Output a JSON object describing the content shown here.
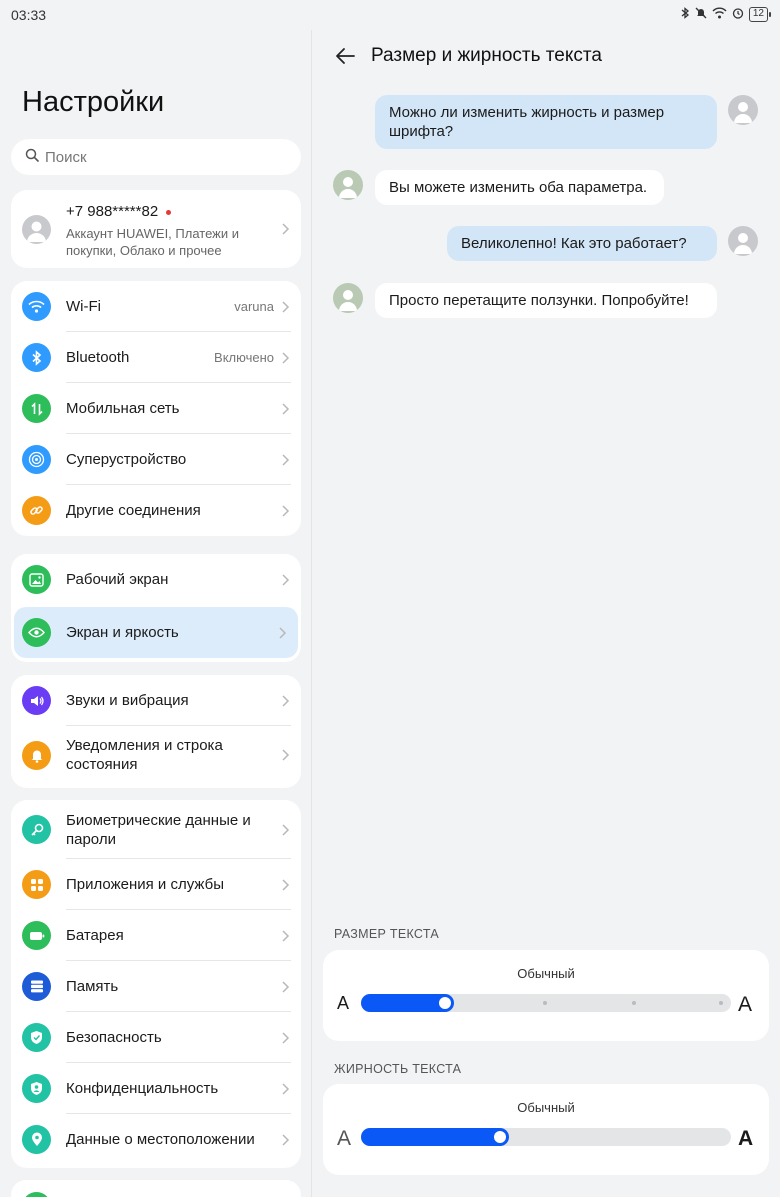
{
  "status": {
    "time": "03:33",
    "battery": "12"
  },
  "left": {
    "title": "Настройки",
    "search_placeholder": "Поиск",
    "account": {
      "name": "+7 988*****82",
      "subtitle": "Аккаунт HUAWEI, Платежи и покупки, Облако и прочее"
    },
    "group1": [
      {
        "label": "Wi-Fi",
        "value": "varuna",
        "icon": "wifi-icon",
        "color": "#2f9bff"
      },
      {
        "label": "Bluetooth",
        "value": "Включено",
        "icon": "bluetooth-icon",
        "color": "#2f9bff"
      },
      {
        "label": "Мобильная сеть",
        "icon": "mobile-network-icon",
        "color": "#2dbd5a"
      },
      {
        "label": "Суперустройство",
        "icon": "superdevice-icon",
        "color": "#2f9bff"
      },
      {
        "label": "Другие соединения",
        "icon": "link-icon",
        "color": "#f59c16"
      }
    ],
    "group2": [
      {
        "label": "Рабочий экран",
        "icon": "home-screen-icon",
        "color": "#2dbd5a"
      },
      {
        "label": "Экран и яркость",
        "icon": "eye-icon",
        "color": "#2dbd5a"
      }
    ],
    "group3": [
      {
        "label": "Звуки и вибрация",
        "icon": "sound-icon",
        "color": "#6a3df5"
      },
      {
        "label": "Уведомления и строка состояния",
        "icon": "bell-icon",
        "color": "#f59c16"
      }
    ],
    "group4": [
      {
        "label": "Биометрические данные и пароли",
        "icon": "key-icon",
        "color": "#22c2a4"
      },
      {
        "label": "Приложения и службы",
        "icon": "apps-icon",
        "color": "#f59c16"
      },
      {
        "label": "Батарея",
        "icon": "battery-icon",
        "color": "#2dbd5a"
      },
      {
        "label": "Память",
        "icon": "storage-icon",
        "color": "#1e5bd6"
      },
      {
        "label": "Безопасность",
        "icon": "shield-icon",
        "color": "#22c2a4"
      },
      {
        "label": "Конфиденциальность",
        "icon": "privacy-icon",
        "color": "#22c2a4"
      },
      {
        "label": "Данные о местоположении",
        "icon": "location-icon",
        "color": "#22c2a4"
      }
    ]
  },
  "detail": {
    "title": "Размер и жирность текста",
    "chat": [
      {
        "from": "me",
        "text": "Можно ли изменить жирность и размер шрифта?"
      },
      {
        "from": "bot",
        "text": "Вы можете изменить оба параметра."
      },
      {
        "from": "me",
        "text": "Великолепно! Как это работает?"
      },
      {
        "from": "bot",
        "text": "Просто перетащите ползунки. Попробуйте!"
      }
    ],
    "size": {
      "label": "РАЗМЕР ТЕКСТА",
      "value_label": "Обычный",
      "level": 0.25,
      "a_small": "A",
      "a_large": "A"
    },
    "weight": {
      "label": "ЖИРНОСТЬ ТЕКСТА",
      "value_label": "Обычный",
      "level": 0.4,
      "a_small": "A",
      "a_large": "A"
    }
  }
}
